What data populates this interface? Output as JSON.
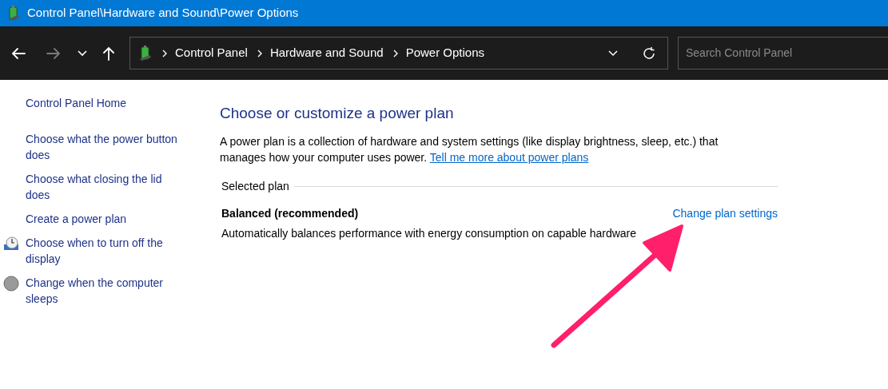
{
  "window": {
    "title": "Control Panel\\Hardware and Sound\\Power Options"
  },
  "toolbar": {
    "back": {
      "disabled": false
    },
    "forward": {
      "disabled": true
    },
    "breadcrumb": [
      "Control Panel",
      "Hardware and Sound",
      "Power Options"
    ],
    "search": {
      "placeholder": "Search Control Panel"
    }
  },
  "sidebar": {
    "items": [
      {
        "label": "Control Panel Home",
        "kind": "home"
      },
      {
        "label": "Choose what the power button does",
        "kind": "link"
      },
      {
        "label": "Choose what closing the lid does",
        "kind": "link"
      },
      {
        "label": "Create a power plan",
        "kind": "link"
      },
      {
        "label": "Choose when to turn off the display",
        "kind": "display-link"
      },
      {
        "label": "Change when the computer sleeps",
        "kind": "sleep-link"
      }
    ]
  },
  "main": {
    "heading": "Choose or customize a power plan",
    "description": "A power plan is a collection of hardware and system settings (like display brightness, sleep, etc.) that manages how your computer uses power.",
    "more_link": "Tell me more about power plans",
    "section_label": "Selected plan",
    "plan": {
      "name": "Balanced (recommended)",
      "settings_link": "Change plan settings",
      "description": "Automatically balances performance with energy consumption on capable hardware"
    }
  },
  "annotation": {
    "kind": "arrow"
  }
}
